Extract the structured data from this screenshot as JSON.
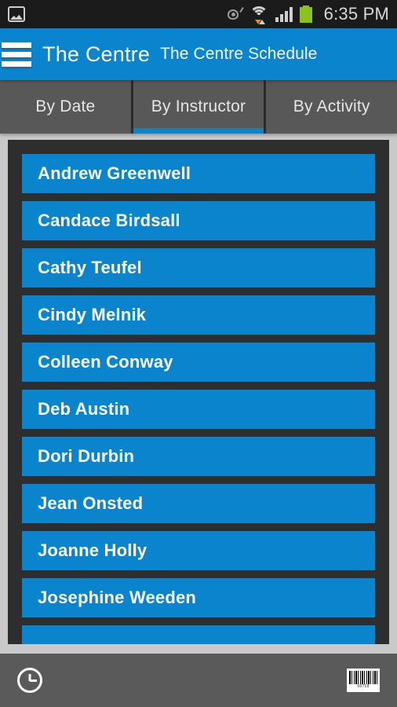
{
  "statusbar": {
    "time": "6:35 PM",
    "icons": {
      "screenshot": "image-icon",
      "smart_stay": "eye-icon",
      "wifi": "wifi-icon",
      "signal": "signal-icon",
      "battery": "battery-icon"
    }
  },
  "appbar": {
    "menu_icon": "hamburger-menu-icon",
    "title": "The Centre",
    "subtitle": "The Centre Schedule"
  },
  "tabs": [
    {
      "label": "By Date",
      "active": false
    },
    {
      "label": "By Instructor",
      "active": true
    },
    {
      "label": "By Activity",
      "active": false
    }
  ],
  "instructors": [
    {
      "name": "Andrew Greenwell"
    },
    {
      "name": "Candace Birdsall"
    },
    {
      "name": "Cathy Teufel"
    },
    {
      "name": "Cindy Melnik"
    },
    {
      "name": "Colleen Conway"
    },
    {
      "name": "Deb Austin"
    },
    {
      "name": "Dori Durbin"
    },
    {
      "name": "Jean Onsted"
    },
    {
      "name": "Joanne Holly"
    },
    {
      "name": "Josephine Weeden"
    },
    {
      "name": ""
    }
  ],
  "bottombar": {
    "clock_icon": "clock-icon",
    "barcode_icon": "barcode-icon",
    "barcode_number": "98758"
  },
  "colors": {
    "accent": "#0b84ce",
    "page_background": "#c9c9c9",
    "card_background": "#2e2e2e",
    "tab_background": "#585858",
    "bottom_bar": "#5a5a5a",
    "status_bar": "#1b1b1b",
    "battery_green": "#8bc220"
  }
}
